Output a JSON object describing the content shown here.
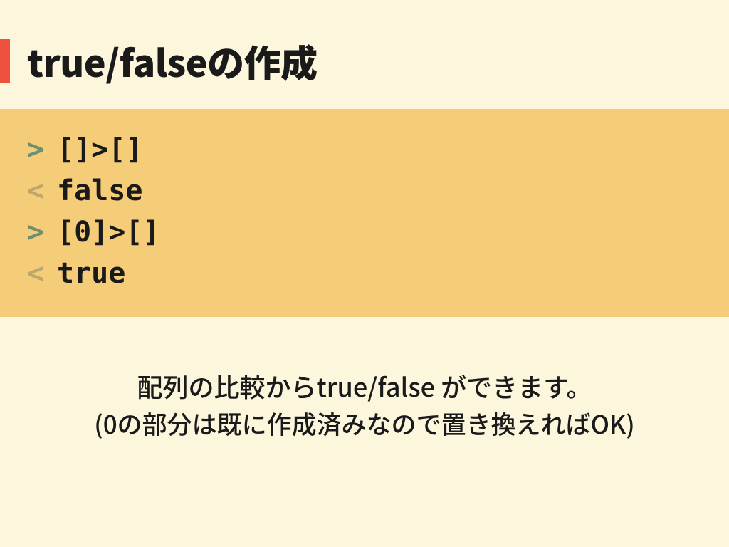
{
  "title": "true/falseの作成",
  "code": {
    "lines": [
      {
        "prompt": ">",
        "kind": "in",
        "text": "[]>[]"
      },
      {
        "prompt": "<",
        "kind": "out",
        "text": "false"
      },
      {
        "prompt": ">",
        "kind": "in",
        "text": "[0]>[]"
      },
      {
        "prompt": "<",
        "kind": "out",
        "text": "true"
      }
    ]
  },
  "footer": {
    "line1": "配列の比較からtrue/false ができます。",
    "line2": "(0の部分は既に作成済みなので置き換えればOK)"
  }
}
